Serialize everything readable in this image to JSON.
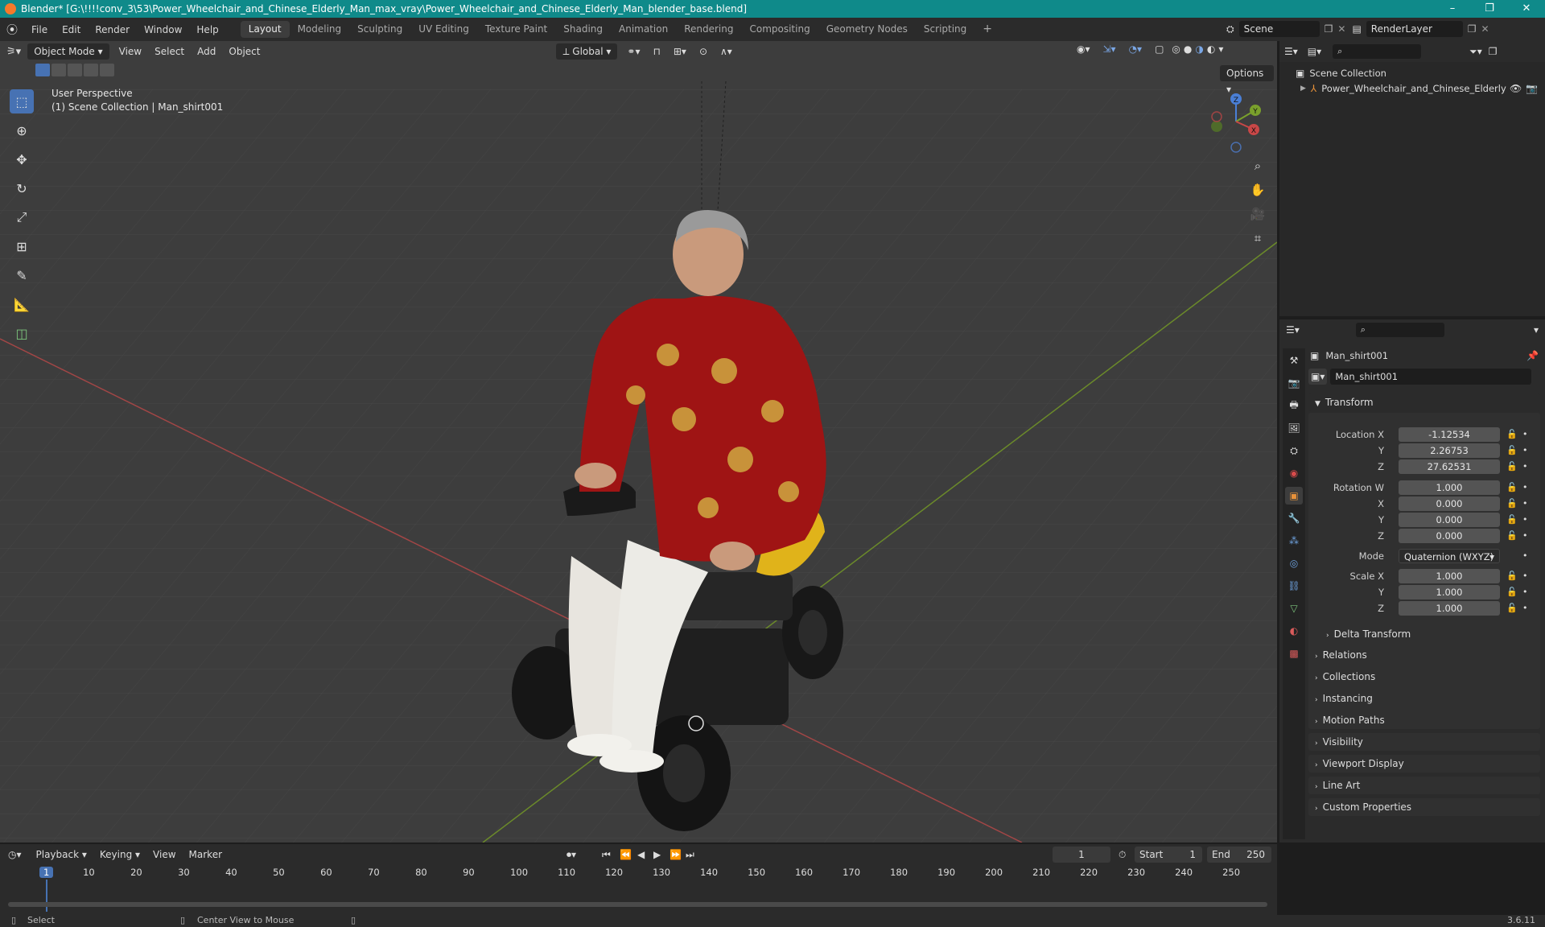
{
  "window": {
    "title": "Blender* [G:\\!!!!conv_3\\53\\Power_Wheelchair_and_Chinese_Elderly_Man_max_vray\\Power_Wheelchair_and_Chinese_Elderly_Man_blender_base.blend]",
    "minimize": "–",
    "maximize": "❐",
    "close": "✕"
  },
  "menu": [
    "File",
    "Edit",
    "Render",
    "Window",
    "Help"
  ],
  "workspaces": [
    "Layout",
    "Modeling",
    "Sculpting",
    "UV Editing",
    "Texture Paint",
    "Shading",
    "Animation",
    "Rendering",
    "Compositing",
    "Geometry Nodes",
    "Scripting"
  ],
  "add_workspace": "+",
  "scene": {
    "label": "Scene",
    "render_layer": "RenderLayer"
  },
  "viewport": {
    "mode": "Object Mode",
    "menus": [
      "View",
      "Select",
      "Add",
      "Object"
    ],
    "transform_orientation": "Global",
    "options_label": "Options",
    "perspective": "User Perspective",
    "context": "(1) Scene Collection | Man_shirt001",
    "gizmo": {
      "x": "X",
      "y": "Y",
      "z": "Z"
    }
  },
  "outliner": {
    "root": "Scene Collection",
    "items": [
      {
        "name": "Power_Wheelchair_and_Chinese_Elderly"
      }
    ]
  },
  "properties": {
    "object_name": "Man_shirt001",
    "data_name": "Man_shirt001",
    "transform_title": "Transform",
    "location": {
      "label": "Location X",
      "x": "-1.12534",
      "y": "2.26753",
      "z": "27.62531"
    },
    "rotation": {
      "label": "Rotation W",
      "w": "1.000",
      "x": "0.000",
      "y": "0.000",
      "z": "0.000"
    },
    "mode": {
      "label": "Mode",
      "value": "Quaternion (WXYZ)"
    },
    "scale": {
      "label": "Scale X",
      "x": "1.000",
      "y": "1.000",
      "z": "1.000"
    },
    "axis_labels": {
      "y": "Y",
      "z": "Z",
      "x": "X"
    },
    "delta_transform": "Delta Transform",
    "panels": [
      "Relations",
      "Collections",
      "Instancing",
      "Motion Paths",
      "Visibility",
      "Viewport Display",
      "Line Art",
      "Custom Properties"
    ]
  },
  "timeline": {
    "menus": [
      "Playback",
      "Keying",
      "View",
      "Marker"
    ],
    "current_frame": "1",
    "start_label": "Start",
    "start": "1",
    "end_label": "End",
    "end": "250",
    "ruler": [
      "1",
      "10",
      "20",
      "30",
      "40",
      "50",
      "60",
      "70",
      "80",
      "90",
      "100",
      "110",
      "120",
      "130",
      "140",
      "150",
      "160",
      "170",
      "180",
      "190",
      "200",
      "210",
      "220",
      "230",
      "240",
      "250"
    ]
  },
  "status": {
    "select": "Select",
    "center_view": "Center View to Mouse",
    "version": "3.6.11"
  }
}
